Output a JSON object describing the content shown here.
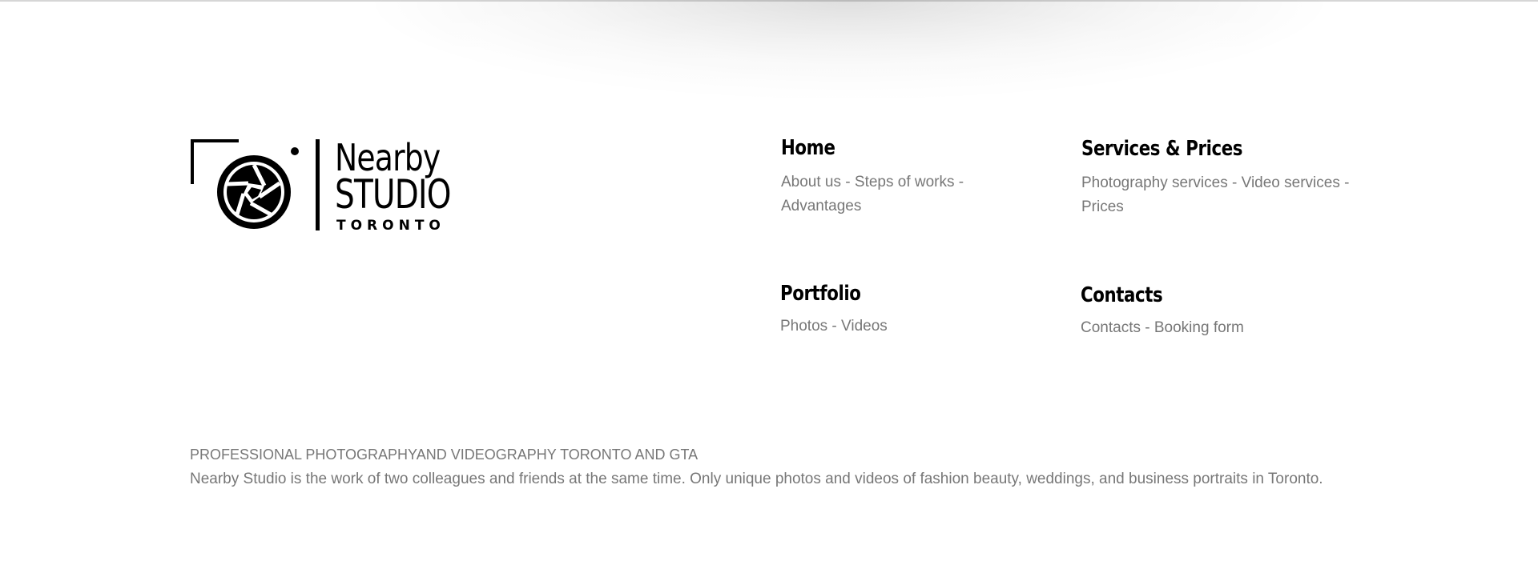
{
  "logo": {
    "line1": "Nearby",
    "line2": "STUDIO",
    "line3": "TORONTO",
    "icon": "camera-aperture-icon"
  },
  "nav": {
    "home": {
      "title": "Home",
      "links": [
        "About us",
        "Steps of works",
        "Advantages"
      ]
    },
    "services": {
      "title": "Services & Prices",
      "links": [
        "Photography services",
        "Video services",
        "Prices"
      ]
    },
    "portfolio": {
      "title": "Portfolio",
      "links": [
        "Photos",
        "Videos"
      ]
    },
    "contacts": {
      "title": "Contacts",
      "links": [
        "Contacts",
        "Booking form"
      ]
    },
    "separator": " - "
  },
  "footer": {
    "tagline": "PROFESSIONAL PHOTOGRAPHYAND VIDEOGRAPHY TORONTO AND GTA",
    "description": "Nearby Studio is the work of two colleagues and friends at the same time. Only unique photos and videos of fashion beauty, weddings, and business portraits in Toronto."
  },
  "colors": {
    "text_muted": "#777777",
    "heading": "#000000",
    "background": "#ffffff"
  }
}
